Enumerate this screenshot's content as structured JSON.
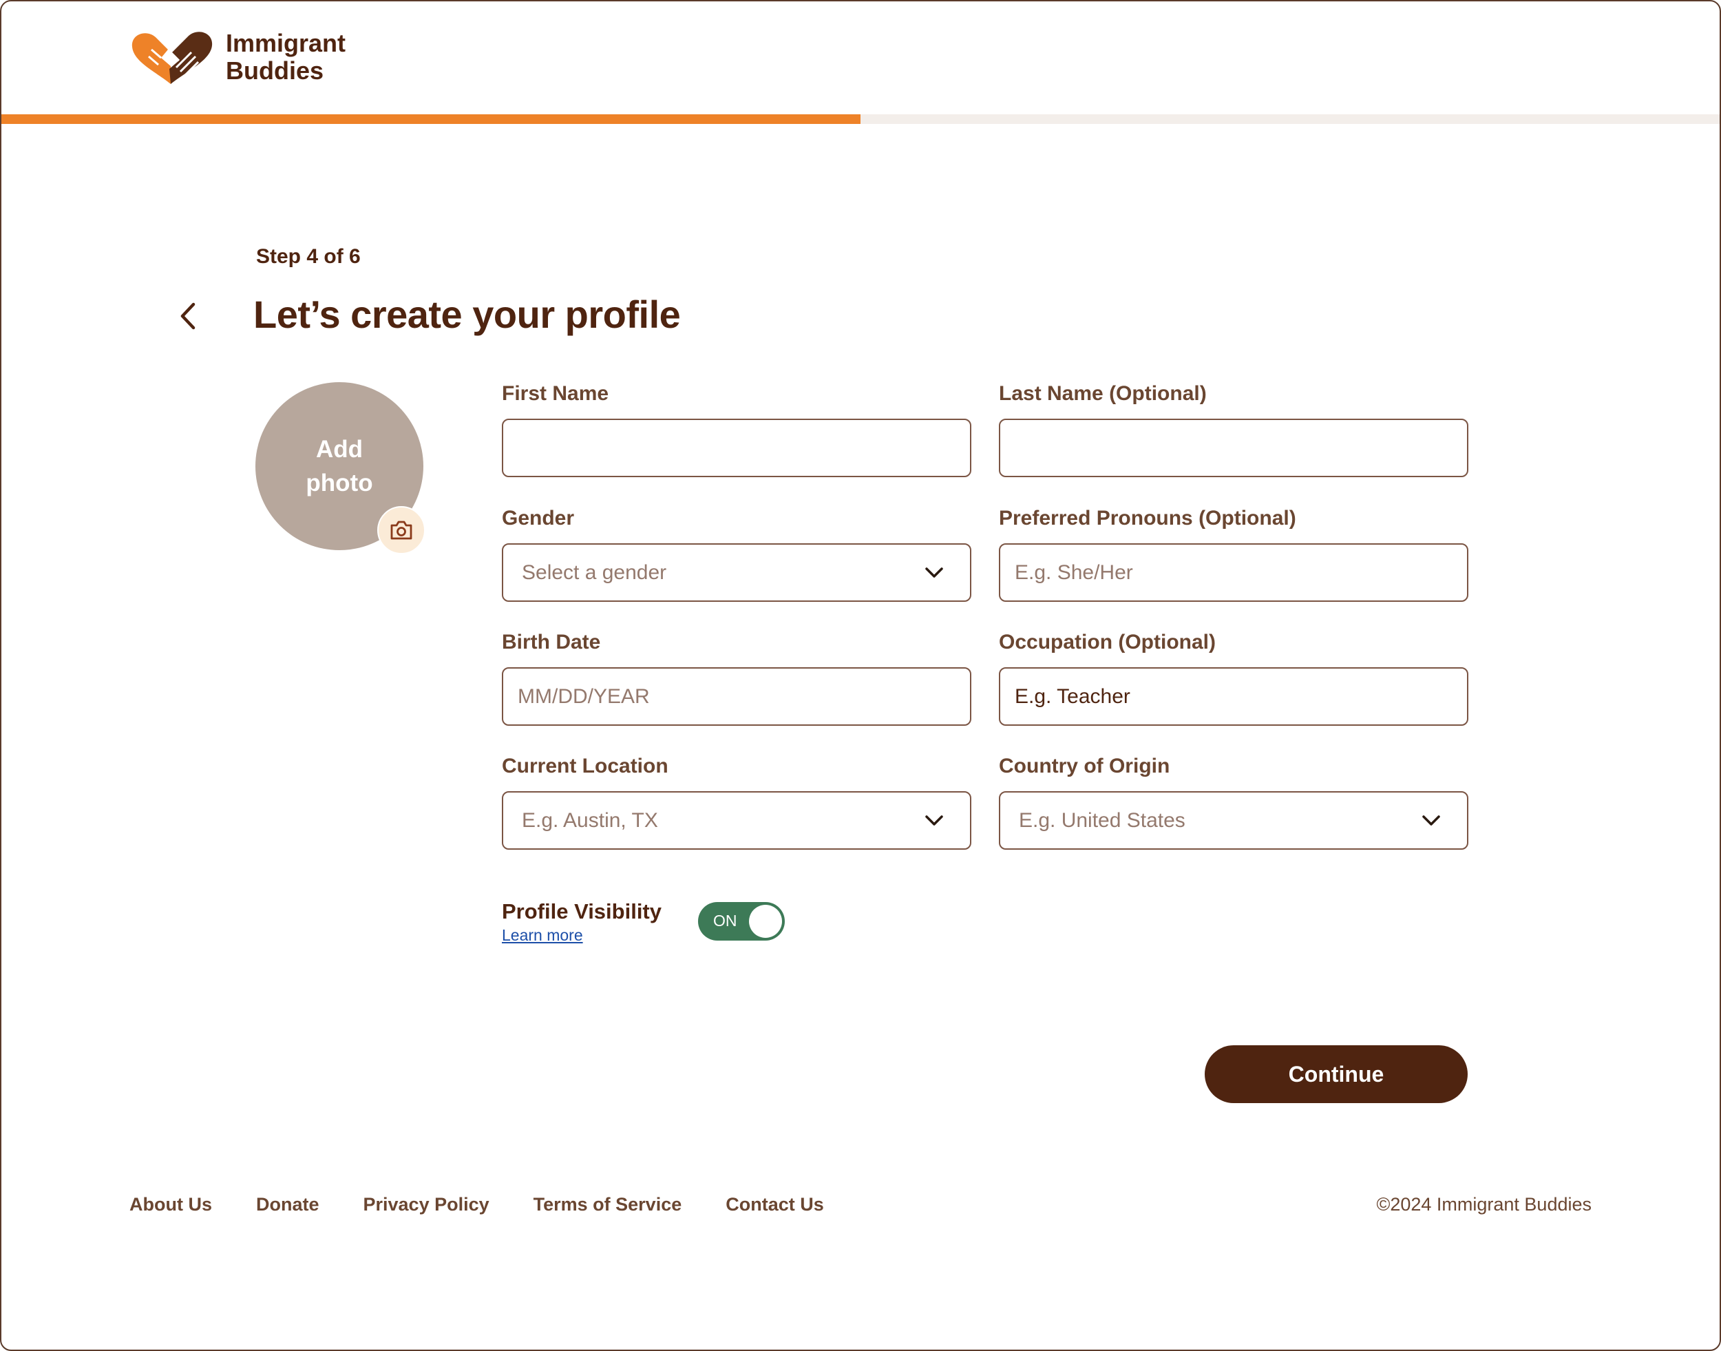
{
  "header": {
    "brand_line1": "Immigrant",
    "brand_line2": "Buddies",
    "progress_fraction": 0.5,
    "accent_color": "#ee8228",
    "brand_color": "#4f2410"
  },
  "page": {
    "step": "Step 4 of 6",
    "title": "Let’s create your profile",
    "back_icon": "chevron-left-icon"
  },
  "photo": {
    "label": "Add photo",
    "icon": "camera-icon"
  },
  "form": {
    "first_name": {
      "label": "First Name",
      "value": "",
      "placeholder": ""
    },
    "last_name": {
      "label": "Last Name (Optional)",
      "value": "",
      "placeholder": ""
    },
    "gender": {
      "label": "Gender",
      "selected": "Select a gender"
    },
    "pronouns": {
      "label": "Preferred Pronouns (Optional)",
      "placeholder": "E.g. She/Her"
    },
    "birth_date": {
      "label": "Birth Date",
      "placeholder": "MM/DD/YEAR"
    },
    "occupation": {
      "label": "Occupation (Optional)",
      "value": "E.g. Teacher"
    },
    "current_location": {
      "label": "Current Location",
      "selected": "E.g. Austin, TX"
    },
    "country_of_origin": {
      "label": "Country of Origin",
      "selected": "E.g. United States"
    }
  },
  "visibility": {
    "label": "Profile Visibility",
    "learn_more": "Learn more",
    "toggle_state": "ON",
    "toggle_color": "#3d7a57"
  },
  "actions": {
    "continue": "Continue"
  },
  "footer": {
    "links": [
      "About Us",
      "Donate",
      "Privacy Policy",
      "Terms of Service",
      "Contact Us"
    ],
    "copyright": "©2024 Immigrant Buddies"
  }
}
